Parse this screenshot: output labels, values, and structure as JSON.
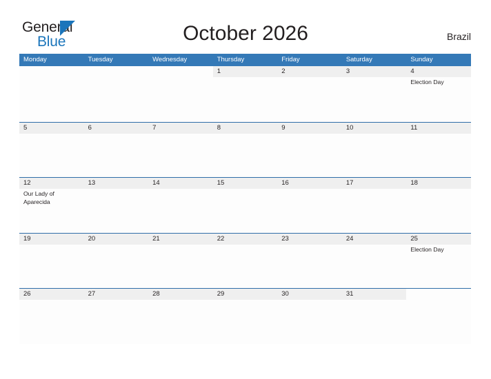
{
  "brand": {
    "name_part1": "General",
    "name_part2": "Blue",
    "accent_color": "#1b75bb"
  },
  "header": {
    "title": "October 2026",
    "country": "Brazil"
  },
  "theme": {
    "weekday_header_bg": "#3479b7",
    "row_divider": "#2d6ca8",
    "day_band_bg": "#efefef",
    "text_color": "#231f20"
  },
  "weekdays": [
    "Monday",
    "Tuesday",
    "Wednesday",
    "Thursday",
    "Friday",
    "Saturday",
    "Sunday"
  ],
  "weeks": [
    [
      {
        "day": "",
        "blank": true,
        "events": []
      },
      {
        "day": "",
        "blank": true,
        "events": []
      },
      {
        "day": "",
        "blank": true,
        "events": []
      },
      {
        "day": "1",
        "blank": false,
        "events": []
      },
      {
        "day": "2",
        "blank": false,
        "events": []
      },
      {
        "day": "3",
        "blank": false,
        "events": []
      },
      {
        "day": "4",
        "blank": false,
        "events": [
          "Election Day"
        ]
      }
    ],
    [
      {
        "day": "5",
        "blank": false,
        "events": []
      },
      {
        "day": "6",
        "blank": false,
        "events": []
      },
      {
        "day": "7",
        "blank": false,
        "events": []
      },
      {
        "day": "8",
        "blank": false,
        "events": []
      },
      {
        "day": "9",
        "blank": false,
        "events": []
      },
      {
        "day": "10",
        "blank": false,
        "events": []
      },
      {
        "day": "11",
        "blank": false,
        "events": []
      }
    ],
    [
      {
        "day": "12",
        "blank": false,
        "events": [
          "Our Lady of Aparecida"
        ]
      },
      {
        "day": "13",
        "blank": false,
        "events": []
      },
      {
        "day": "14",
        "blank": false,
        "events": []
      },
      {
        "day": "15",
        "blank": false,
        "events": []
      },
      {
        "day": "16",
        "blank": false,
        "events": []
      },
      {
        "day": "17",
        "blank": false,
        "events": []
      },
      {
        "day": "18",
        "blank": false,
        "events": []
      }
    ],
    [
      {
        "day": "19",
        "blank": false,
        "events": []
      },
      {
        "day": "20",
        "blank": false,
        "events": []
      },
      {
        "day": "21",
        "blank": false,
        "events": []
      },
      {
        "day": "22",
        "blank": false,
        "events": []
      },
      {
        "day": "23",
        "blank": false,
        "events": []
      },
      {
        "day": "24",
        "blank": false,
        "events": []
      },
      {
        "day": "25",
        "blank": false,
        "events": [
          "Election Day"
        ]
      }
    ],
    [
      {
        "day": "26",
        "blank": false,
        "events": []
      },
      {
        "day": "27",
        "blank": false,
        "events": []
      },
      {
        "day": "28",
        "blank": false,
        "events": []
      },
      {
        "day": "29",
        "blank": false,
        "events": []
      },
      {
        "day": "30",
        "blank": false,
        "events": []
      },
      {
        "day": "31",
        "blank": false,
        "events": []
      },
      {
        "day": "",
        "blank": true,
        "events": []
      }
    ]
  ]
}
